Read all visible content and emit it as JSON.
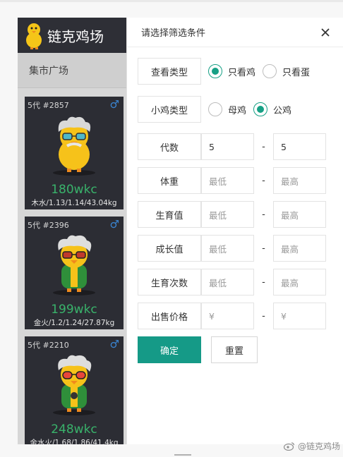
{
  "app": {
    "title": "链克鸡场",
    "market_label": "集市广场",
    "cards": [
      {
        "id": "5代 #2857",
        "sex": "♂",
        "price": "180wkc",
        "stats": "木水/1.13/1.14/43.04kg"
      },
      {
        "id": "5代 #2396",
        "sex": "♂",
        "price": "199wkc",
        "stats": "金火/1.2/1.24/27.87kg"
      },
      {
        "id": "5代 #2210",
        "sex": "♂",
        "price": "248wkc",
        "stats": "金水火/1.68/1.86/41.4kg"
      }
    ]
  },
  "panel": {
    "title": "请选择筛选条件",
    "view_type": {
      "label": "查看类型",
      "options": [
        "只看鸡",
        "只看蛋"
      ],
      "selected": "只看鸡"
    },
    "chick_type": {
      "label": "小鸡类型",
      "options": [
        "母鸡",
        "公鸡"
      ],
      "selected": "公鸡"
    },
    "generation": {
      "label": "代数",
      "min_value": "5",
      "max_value": "5"
    },
    "weight": {
      "label": "体重",
      "min_placeholder": "最低",
      "max_placeholder": "最高"
    },
    "fertility": {
      "label": "生育值",
      "min_placeholder": "最低",
      "max_placeholder": "最高"
    },
    "growth": {
      "label": "成长值",
      "min_placeholder": "最低",
      "max_placeholder": "最高"
    },
    "breed_count": {
      "label": "生育次数",
      "min_placeholder": "最低",
      "max_placeholder": "最高"
    },
    "price": {
      "label": "出售价格",
      "min_prefix": "¥",
      "max_prefix": "¥"
    },
    "range_separator": "-",
    "confirm_label": "确定",
    "reset_label": "重置"
  },
  "watermark": "@链克鸡场",
  "colors": {
    "accent": "#159a87",
    "dark_header": "#2e2f36",
    "price_green": "#39b36b",
    "male_blue": "#3a86d4"
  }
}
